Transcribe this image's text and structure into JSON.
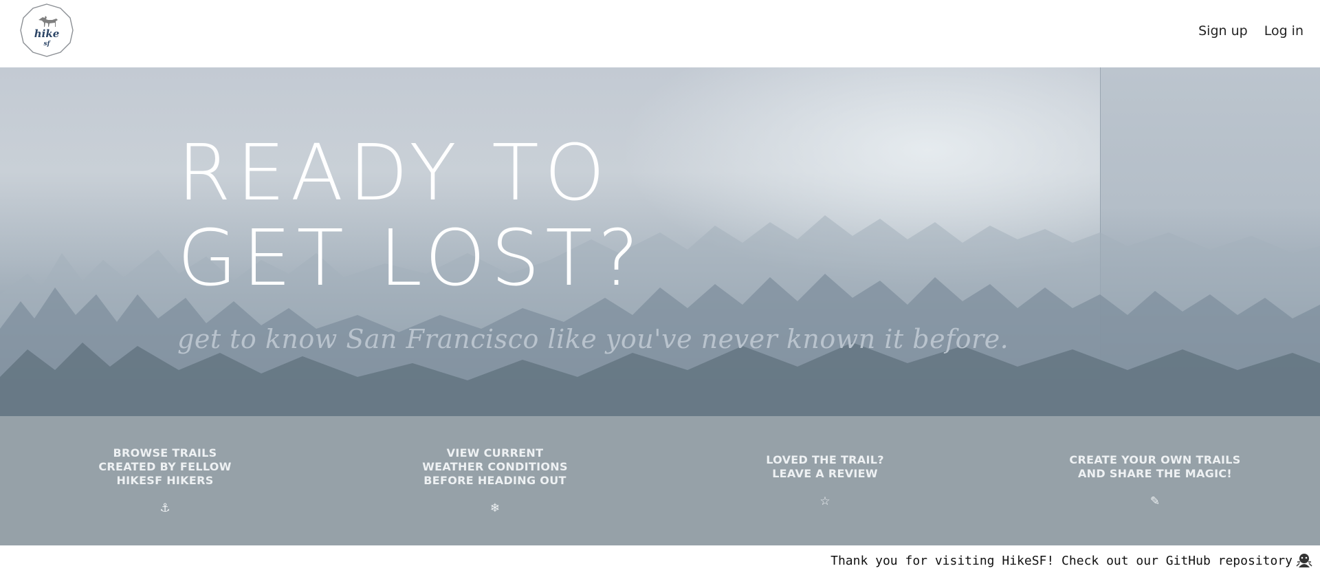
{
  "header": {
    "logo": {
      "line1": "hike",
      "line2": "sf",
      "icon": "dog-icon"
    },
    "nav": {
      "signup": "Sign up",
      "login": "Log in"
    }
  },
  "hero": {
    "title_line1": "READY TO",
    "title_line2": "GET LOST?",
    "subtitle": "get to know San Francisco like you've never known it before."
  },
  "features": [
    {
      "text": "BROWSE TRAILS\nCREATED BY FELLOW\nHIKESF HIKERS",
      "icon": "⚓",
      "icon_name": "anchor-icon"
    },
    {
      "text": "VIEW CURRENT\nWEATHER CONDITIONS\nBEFORE HEADING OUT",
      "icon": "❄",
      "icon_name": "snowflake-icon"
    },
    {
      "text": "LOVED THE TRAIL?\nLEAVE A REVIEW",
      "icon": "☆",
      "icon_name": "star-icon"
    },
    {
      "text": "CREATE YOUR OWN TRAILS\nAND SHARE THE MAGIC!",
      "icon": "✎",
      "icon_name": "pencil-icon"
    }
  ],
  "footer": {
    "text": "Thank you for visiting HikeSF! Check out our GitHub repository",
    "icon": "github-icon"
  },
  "colors": {
    "feature_band": "#96a1a8",
    "hero_title": "#ffffff",
    "hero_subtitle": "#b9c3cd"
  }
}
